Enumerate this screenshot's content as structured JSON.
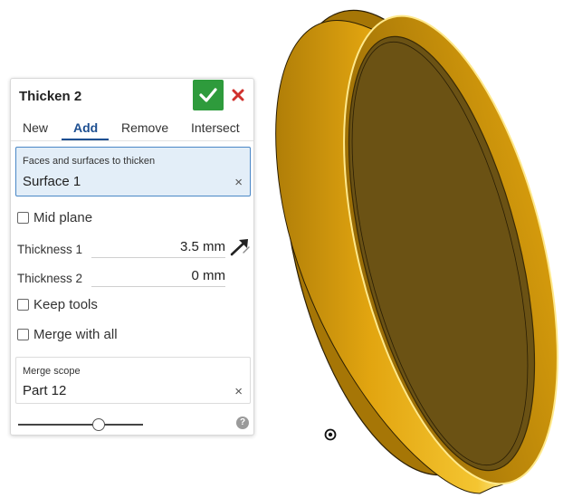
{
  "dialog": {
    "title": "Thicken 2",
    "ok_icon": "check-icon",
    "cancel_icon": "close-icon",
    "colors": {
      "ok_button": "#2e9b3c",
      "cancel": "#d0312d",
      "accent": "#1d4f91",
      "selection_bg": "#e3eef8",
      "selection_border": "#4a87c6"
    }
  },
  "tabs": [
    {
      "label": "New",
      "active": false
    },
    {
      "label": "Add",
      "active": true
    },
    {
      "label": "Remove",
      "active": false
    },
    {
      "label": "Intersect",
      "active": false
    }
  ],
  "selection": {
    "label": "Faces and surfaces to thicken",
    "value": "Surface 1",
    "clear": "×"
  },
  "mid_plane": {
    "label": "Mid plane",
    "checked": false
  },
  "thickness1": {
    "label": "Thickness 1",
    "value": "3.5 mm",
    "direction_icon": "opposite-direction-arrow-icon"
  },
  "thickness2": {
    "label": "Thickness 2",
    "value": "0 mm"
  },
  "keep_tools": {
    "label": "Keep tools",
    "checked": false
  },
  "merge_with_all": {
    "label": "Merge with all",
    "checked": false
  },
  "merge_scope": {
    "label": "Merge scope",
    "value": "Part 12",
    "clear": "×"
  },
  "footer": {
    "help": "?",
    "help_icon": "help-icon",
    "slider_level": 0.66
  },
  "viewport": {
    "part_colors": {
      "body": "#e5aa18",
      "face": "#6b5214",
      "highlight": "#ffe98c",
      "edge": "#3a2a05"
    },
    "origin_icon": "origin-icon"
  }
}
